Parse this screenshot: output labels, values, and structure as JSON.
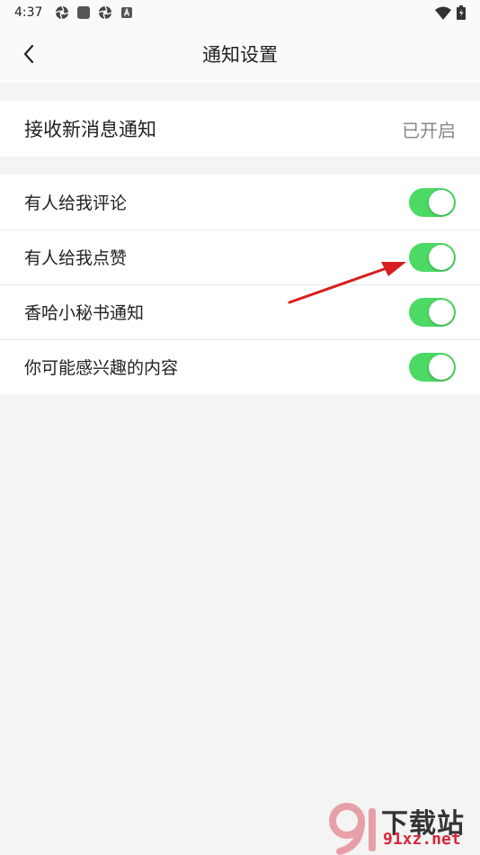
{
  "status_bar": {
    "time": "4:37",
    "icons": [
      "aperture-icon",
      "square-app-icon",
      "aperture-icon",
      "a-badge-icon"
    ],
    "right_icons": [
      "wifi-icon",
      "battery-icon"
    ]
  },
  "nav": {
    "title": "通知设置",
    "back_icon": "chevron-left-icon"
  },
  "receive": {
    "label": "接收新消息通知",
    "value": "已开启"
  },
  "settings": [
    {
      "label": "有人给我评论",
      "enabled": true
    },
    {
      "label": "有人给我点赞",
      "enabled": true
    },
    {
      "label": "香哈小秘书通知",
      "enabled": true
    },
    {
      "label": "你可能感兴趣的内容",
      "enabled": true
    }
  ],
  "watermark": {
    "mark": "9",
    "text": "下载站",
    "url": "91xz.net"
  },
  "colors": {
    "toggle_on": "#4cd964",
    "annotation_arrow": "#d81e1e",
    "watermark_red": "#d7263d"
  }
}
